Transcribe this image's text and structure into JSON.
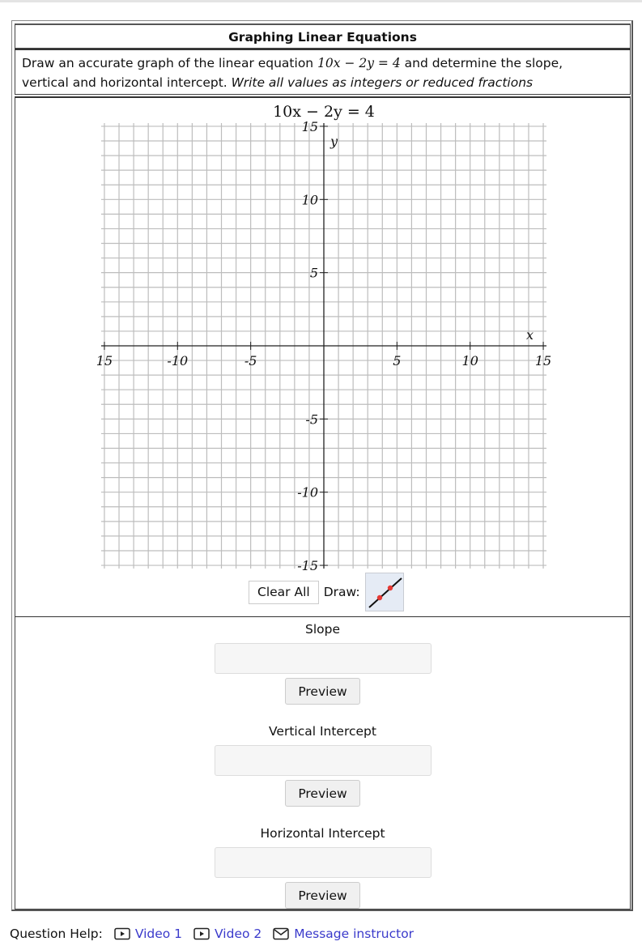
{
  "question": {
    "title": "Graphing Linear Equations",
    "prompt_before": "Draw an accurate graph of the linear equation ",
    "equation_inline": "10x − 2y = 4",
    "prompt_after": " and determine the slope,",
    "prompt_line2": "vertical and horizontal intercept. ",
    "instruction": "Write all values as integers or reduced fractions"
  },
  "graph": {
    "title": "10x − 2y = 4",
    "x_axis_label": "x",
    "y_axis_label": "y",
    "x_range": [
      -15,
      15
    ],
    "y_range": [
      -15,
      15
    ],
    "grid_step": 1,
    "tick_labels_x": [
      "15",
      "-10",
      "-5",
      "5",
      "10",
      "15"
    ],
    "tick_values_x": [
      -15,
      -10,
      -5,
      5,
      10,
      15
    ],
    "tick_labels_y": [
      "15",
      "10",
      "5",
      "-5",
      "-10",
      "-15"
    ],
    "tick_values_y": [
      15,
      10,
      5,
      -5,
      -10,
      -15
    ],
    "colors": {
      "grid": "#bdbdbd",
      "axis": "#222222",
      "point": "#e53935"
    }
  },
  "controls": {
    "clear_all_label": "Clear All",
    "draw_label": "Draw:",
    "draw_tool": "line-tool-icon"
  },
  "answers": [
    {
      "label": "Slope",
      "value": "",
      "preview_label": "Preview"
    },
    {
      "label": "Vertical Intercept",
      "value": "",
      "preview_label": "Preview"
    },
    {
      "label": "Horizontal Intercept",
      "value": "",
      "preview_label": "Preview"
    }
  ],
  "help": {
    "label": "Question Help:",
    "links": [
      {
        "label": "Video 1",
        "icon": "video-icon"
      },
      {
        "label": "Video 2",
        "icon": "video-icon"
      },
      {
        "label": "Message instructor",
        "icon": "mail-icon"
      }
    ],
    "link_color": "#3a3acb"
  }
}
